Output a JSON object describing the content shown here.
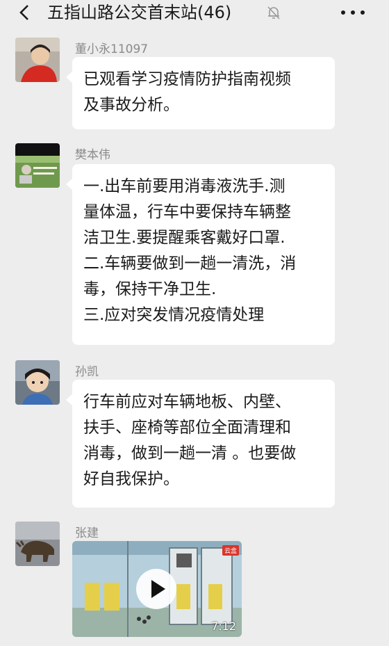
{
  "header": {
    "title": "五指山路公交首末站(46)",
    "back_icon": "chevron-left-icon",
    "mute_icon": "bell-muted-icon",
    "more_icon": "more-dots-icon"
  },
  "messages": [
    {
      "sender": "董小永11097",
      "avatar": "avatar-child-red-shirt",
      "lines": [
        "已观看学习疫情防护指南视频",
        "及事故分析。"
      ]
    },
    {
      "sender": "樊本伟",
      "avatar": "avatar-garden",
      "lines": [
        "一.出车前要用消毒液洗手.测",
        "量体温，行车中要保持车辆整",
        "洁卫生.要提醒乘客戴好口罩.",
        "二.车辆要做到一趟一清洗，消",
        "毒，保持干净卫生.",
        "三.应对突发情况疫情处理"
      ]
    },
    {
      "sender": "孙凯",
      "avatar": "avatar-child",
      "lines": [
        "行车前应对车辆地板、内壁、",
        "扶手、座椅等部位全面清理和",
        "消毒，做到一趟一清 。也要做",
        "好自我保护。"
      ]
    },
    {
      "sender": "张建",
      "avatar": "avatar-bull-statue",
      "video": {
        "duration": "7:12",
        "badge": "云盒",
        "play_icon": "play-icon"
      }
    }
  ],
  "colors": {
    "background": "#ededed",
    "bubble": "#ffffff",
    "sender_text": "#8a8a8a"
  }
}
